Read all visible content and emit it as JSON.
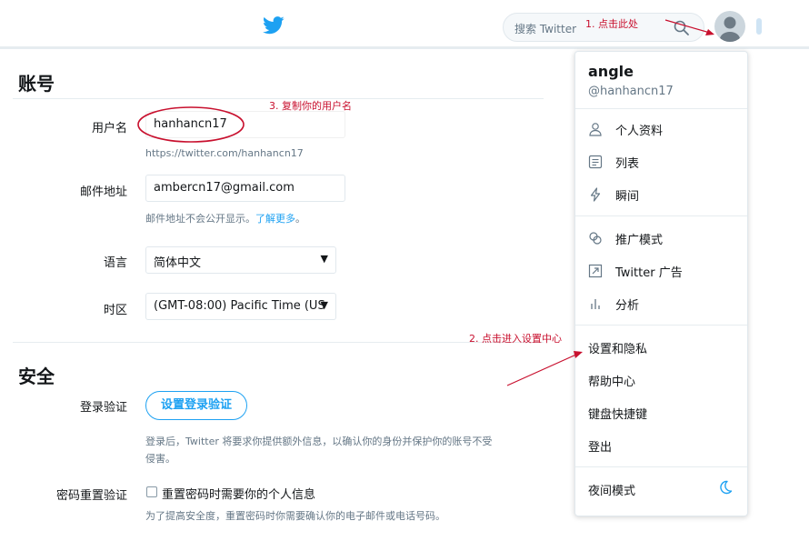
{
  "search": {
    "placeholder": "搜索 Twitter"
  },
  "account": {
    "title": "账号",
    "username_label": "用户名",
    "username_value": "hanhancn17",
    "username_url": "https://twitter.com/hanhancn17",
    "email_label": "邮件地址",
    "email_value": "ambercn17@gmail.com",
    "email_hint": "邮件地址不会公开显示。",
    "email_hint_link": "了解更多",
    "email_hint_end": "。",
    "language_label": "语言",
    "language_value": "简体中文",
    "timezone_label": "时区",
    "timezone_value": "(GMT-08:00) Pacific Time (US"
  },
  "security": {
    "title": "安全",
    "login_verify_label": "登录验证",
    "login_verify_button": "设置登录验证",
    "login_verify_hint_1": "登录后，Twitter 将要求你提供额外信息，以确认你的身份并保护你的账号不受",
    "login_verify_hint_2": "侵害。",
    "reset_label": "密码重置验证",
    "reset_checkbox_label": "重置密码时需要你的个人信息",
    "reset_hint": "为了提高安全度，重置密码时你需要确认你的电子邮件或电话号码。"
  },
  "menu": {
    "name": "angle",
    "handle": "@hanhancn17",
    "items": [
      {
        "label": "个人资料",
        "icon": "person-icon"
      },
      {
        "label": "列表",
        "icon": "list-icon"
      },
      {
        "label": "瞬间",
        "icon": "lightning-icon"
      },
      {
        "label": "推广模式",
        "icon": "promote-icon"
      },
      {
        "label": "Twitter 广告",
        "icon": "ads-icon"
      },
      {
        "label": "分析",
        "icon": "analytics-icon"
      },
      {
        "label": "设置和隐私"
      },
      {
        "label": "帮助中心"
      },
      {
        "label": "键盘快捷键"
      },
      {
        "label": "登出"
      },
      {
        "label": "夜间模式",
        "icon": "moon-icon"
      }
    ]
  },
  "annotations": {
    "step1": "1. 点击此处",
    "step2": "2. 点击进入设置中心",
    "step3": "3. 复制你的用户名"
  },
  "colors": {
    "accent": "#1da1f2",
    "annotation": "#c8102e"
  }
}
